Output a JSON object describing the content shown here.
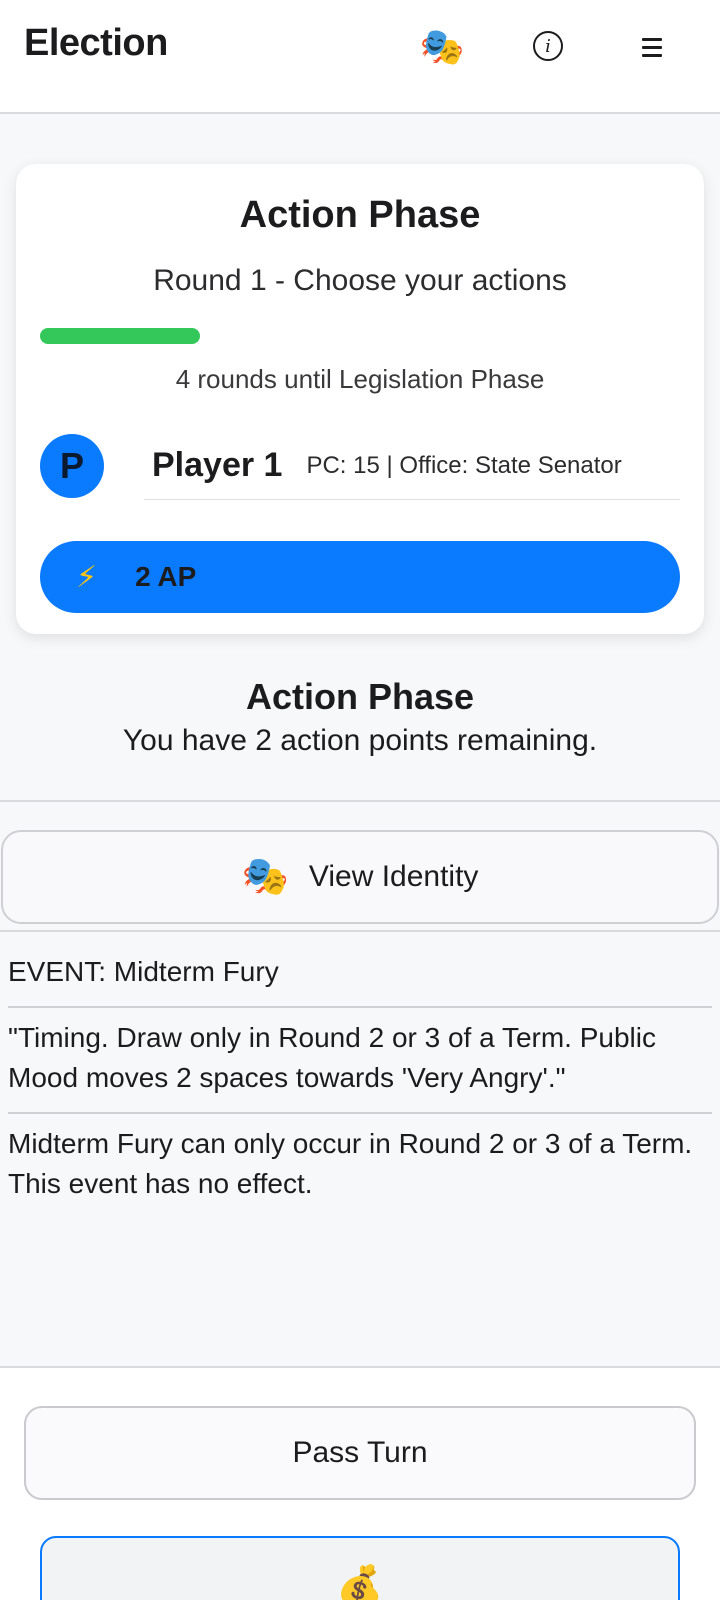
{
  "header": {
    "title": "Election",
    "identity_icon": "🎭",
    "info_icon": "ⓘ",
    "menu_icon": "hamburger-menu"
  },
  "phase_card": {
    "title": "Action Phase",
    "subtitle": "Round 1 - Choose your actions",
    "progress": 0.25,
    "progress_color": "#34c759",
    "rounds_text": "4 rounds until Legislation Phase",
    "player": {
      "avatar_letter": "P",
      "name": "Player 1",
      "stats": "PC: 15 | Office: State Senator"
    },
    "ap_icon": "⚡",
    "ap_label": "2 AP",
    "accent_color": "#0a7aff"
  },
  "main": {
    "title": "Action Phase",
    "description": "You have 2 action points remaining.",
    "identity_button": {
      "icon": "🎭",
      "label": "View Identity"
    },
    "event": {
      "heading": "EVENT: Midterm Fury",
      "quote": "\"Timing. Draw only in Round 2 or 3 of a Term. Public Mood moves 2 spaces towards 'Very Angry'.\"",
      "result": "Midterm Fury can only occur in Round 2 or 3 of a Term. This event has no effect."
    }
  },
  "bottom": {
    "pass_label": "Pass Turn",
    "card_icon": "💰"
  }
}
